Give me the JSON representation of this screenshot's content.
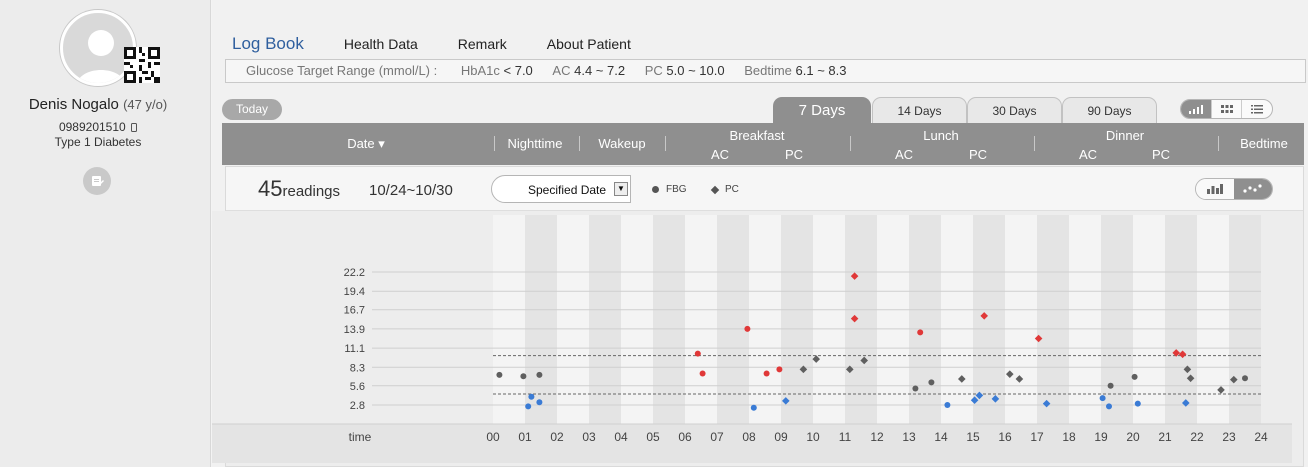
{
  "patient": {
    "name": "Denis Nogalo",
    "age": "(47 y/o)",
    "phone": "0989201510",
    "type": "Type 1 Diabetes"
  },
  "nav": {
    "tabs": [
      "Log Book",
      "Health Data",
      "Remark",
      "About Patient"
    ],
    "active": "Log Book"
  },
  "target_range": {
    "label": "Glucose Target Range (mmol/L) :",
    "hba1c_label": "HbA1c",
    "hba1c_value": "< 7.0",
    "ac_label": "AC",
    "ac_value": "4.4 ~ 7.2",
    "pc_label": "PC",
    "pc_value": "5.0 ~ 10.0",
    "bedtime_label": "Bedtime",
    "bedtime_value": "6.1 ~ 8.3"
  },
  "toolbar": {
    "today": "Today",
    "range_tabs": [
      "7 Days",
      "14 Days",
      "30 Days",
      "90 Days"
    ],
    "active_range": "7 Days"
  },
  "columns": {
    "date": "Date ▾",
    "nighttime": "Nighttime",
    "wakeup": "Wakeup",
    "breakfast": "Breakfast",
    "lunch": "Lunch",
    "dinner": "Dinner",
    "bedtime": "Bedtime",
    "ac": "AC",
    "pc": "PC"
  },
  "summary": {
    "count": "45",
    "count_label": "readings",
    "date_range": "10/24~10/30",
    "date_select": "Specified Date",
    "legend_fbg": "FBG",
    "legend_pc": "PC"
  },
  "colors": {
    "high": "#e03838",
    "normal": "#5f5f5f",
    "low": "#3a7bd5",
    "header": "#8f8f8f",
    "accent": "#2f5f9e"
  },
  "chart_data": {
    "type": "scatter",
    "xlabel": "time",
    "xlim": [
      0,
      24
    ],
    "y_ticks": [
      2.8,
      5.6,
      8.3,
      11.1,
      13.9,
      16.7,
      19.4,
      22.2
    ],
    "x_ticks": [
      "00",
      "01",
      "02",
      "03",
      "04",
      "05",
      "06",
      "07",
      "08",
      "09",
      "10",
      "11",
      "12",
      "13",
      "14",
      "15",
      "16",
      "17",
      "18",
      "19",
      "20",
      "21",
      "22",
      "23",
      "24"
    ],
    "target_lines": [
      4.4,
      10.0
    ],
    "points": [
      {
        "x": 0.2,
        "y": 7.2,
        "shape": "circle",
        "status": "normal"
      },
      {
        "x": 0.95,
        "y": 7.0,
        "shape": "circle",
        "status": "normal"
      },
      {
        "x": 1.45,
        "y": 7.2,
        "shape": "circle",
        "status": "normal"
      },
      {
        "x": 1.1,
        "y": 2.6,
        "shape": "circle",
        "status": "low"
      },
      {
        "x": 1.2,
        "y": 4.0,
        "shape": "circle",
        "status": "low"
      },
      {
        "x": 1.45,
        "y": 3.2,
        "shape": "circle",
        "status": "low"
      },
      {
        "x": 6.4,
        "y": 10.3,
        "shape": "circle",
        "status": "high"
      },
      {
        "x": 6.55,
        "y": 7.4,
        "shape": "circle",
        "status": "high"
      },
      {
        "x": 7.95,
        "y": 13.9,
        "shape": "circle",
        "status": "high"
      },
      {
        "x": 8.15,
        "y": 2.4,
        "shape": "circle",
        "status": "low"
      },
      {
        "x": 8.55,
        "y": 7.4,
        "shape": "circle",
        "status": "high"
      },
      {
        "x": 8.95,
        "y": 8.0,
        "shape": "circle",
        "status": "high"
      },
      {
        "x": 9.15,
        "y": 3.4,
        "shape": "diamond",
        "status": "low"
      },
      {
        "x": 9.7,
        "y": 8.0,
        "shape": "diamond",
        "status": "normal"
      },
      {
        "x": 10.1,
        "y": 9.5,
        "shape": "diamond",
        "status": "normal"
      },
      {
        "x": 11.15,
        "y": 8.0,
        "shape": "diamond",
        "status": "normal"
      },
      {
        "x": 11.6,
        "y": 9.3,
        "shape": "diamond",
        "status": "normal"
      },
      {
        "x": 11.3,
        "y": 21.6,
        "shape": "diamond",
        "status": "high"
      },
      {
        "x": 11.3,
        "y": 15.4,
        "shape": "diamond",
        "status": "high"
      },
      {
        "x": 13.2,
        "y": 5.2,
        "shape": "circle",
        "status": "normal"
      },
      {
        "x": 13.35,
        "y": 13.4,
        "shape": "circle",
        "status": "high"
      },
      {
        "x": 13.7,
        "y": 6.1,
        "shape": "circle",
        "status": "normal"
      },
      {
        "x": 14.2,
        "y": 2.8,
        "shape": "circle",
        "status": "low"
      },
      {
        "x": 14.65,
        "y": 6.6,
        "shape": "diamond",
        "status": "normal"
      },
      {
        "x": 15.05,
        "y": 3.5,
        "shape": "diamond",
        "status": "low"
      },
      {
        "x": 15.2,
        "y": 4.2,
        "shape": "diamond",
        "status": "low"
      },
      {
        "x": 15.35,
        "y": 15.8,
        "shape": "diamond",
        "status": "high"
      },
      {
        "x": 15.7,
        "y": 3.7,
        "shape": "diamond",
        "status": "low"
      },
      {
        "x": 16.15,
        "y": 7.3,
        "shape": "diamond",
        "status": "normal"
      },
      {
        "x": 16.45,
        "y": 6.6,
        "shape": "diamond",
        "status": "normal"
      },
      {
        "x": 17.05,
        "y": 12.5,
        "shape": "diamond",
        "status": "high"
      },
      {
        "x": 17.3,
        "y": 3.0,
        "shape": "diamond",
        "status": "low"
      },
      {
        "x": 19.05,
        "y": 3.8,
        "shape": "circle",
        "status": "low"
      },
      {
        "x": 19.3,
        "y": 5.6,
        "shape": "circle",
        "status": "normal"
      },
      {
        "x": 19.25,
        "y": 2.6,
        "shape": "circle",
        "status": "low"
      },
      {
        "x": 20.15,
        "y": 3.0,
        "shape": "circle",
        "status": "low"
      },
      {
        "x": 20.05,
        "y": 6.9,
        "shape": "circle",
        "status": "normal"
      },
      {
        "x": 21.35,
        "y": 10.4,
        "shape": "diamond",
        "status": "high"
      },
      {
        "x": 21.55,
        "y": 10.2,
        "shape": "diamond",
        "status": "high"
      },
      {
        "x": 21.7,
        "y": 8.0,
        "shape": "diamond",
        "status": "normal"
      },
      {
        "x": 21.8,
        "y": 6.7,
        "shape": "diamond",
        "status": "normal"
      },
      {
        "x": 21.65,
        "y": 3.1,
        "shape": "diamond",
        "status": "low"
      },
      {
        "x": 22.75,
        "y": 5.0,
        "shape": "diamond",
        "status": "normal"
      },
      {
        "x": 23.15,
        "y": 6.5,
        "shape": "diamond",
        "status": "normal"
      },
      {
        "x": 23.5,
        "y": 6.7,
        "shape": "circle",
        "status": "normal"
      }
    ]
  }
}
